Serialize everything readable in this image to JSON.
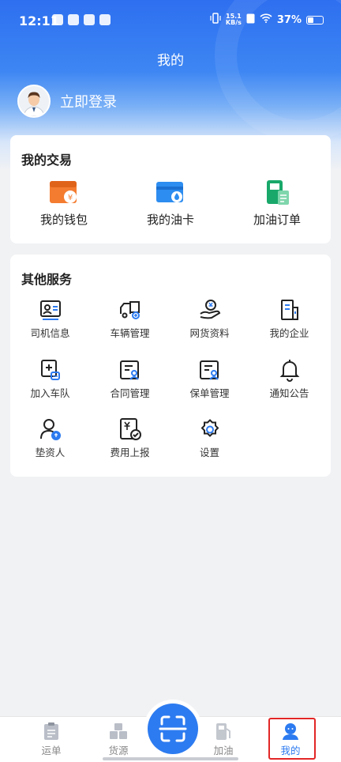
{
  "status_bar": {
    "time": "12:11",
    "net_speed_top": "15.1",
    "net_speed_unit": "KB/s",
    "battery": "37%"
  },
  "header": {
    "title": "我的"
  },
  "profile": {
    "login_label": "立即登录"
  },
  "trade": {
    "title": "我的交易",
    "items": [
      {
        "label": "我的钱包",
        "icon": "wallet-icon"
      },
      {
        "label": "我的油卡",
        "icon": "fuel-card-icon"
      },
      {
        "label": "加油订单",
        "icon": "fuel-order-icon"
      }
    ]
  },
  "services": {
    "title": "其他服务",
    "items": [
      {
        "label": "司机信息",
        "icon": "driver-info-icon"
      },
      {
        "label": "车辆管理",
        "icon": "vehicle-manage-icon"
      },
      {
        "label": "网货资料",
        "icon": "cargo-data-icon"
      },
      {
        "label": "我的企业",
        "icon": "enterprise-icon"
      },
      {
        "label": "加入车队",
        "icon": "join-fleet-icon"
      },
      {
        "label": "合同管理",
        "icon": "contract-icon"
      },
      {
        "label": "保单管理",
        "icon": "policy-icon"
      },
      {
        "label": "通知公告",
        "icon": "bell-icon"
      },
      {
        "label": "垫资人",
        "icon": "funder-icon"
      },
      {
        "label": "费用上报",
        "icon": "expense-report-icon"
      },
      {
        "label": "设置",
        "icon": "gear-icon"
      }
    ]
  },
  "tabbar": {
    "items": [
      {
        "label": "运单",
        "icon": "waybill-icon"
      },
      {
        "label": "货源",
        "icon": "cargo-source-icon"
      },
      {
        "label": "加油",
        "icon": "fuel-pump-icon"
      },
      {
        "label": "我的",
        "icon": "user-icon"
      }
    ],
    "active_index": 3
  },
  "colors": {
    "primary": "#2d7bf0",
    "orange": "#f47c30",
    "green": "#19a86a",
    "highlight": "#e32626"
  }
}
